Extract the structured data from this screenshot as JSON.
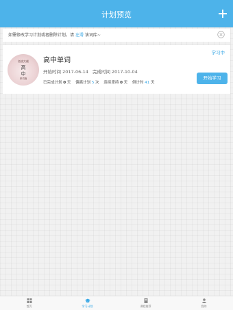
{
  "header": {
    "title": "计划预览",
    "add_icon": "plus-icon"
  },
  "notice": {
    "prefix": "如需修改学习计划或者删除计划，请",
    "link": "左滑",
    "suffix": "该词库~",
    "close_icon": "close-circle-icon"
  },
  "plan": {
    "status": "学习中",
    "cover": {
      "line1": "名校大佬",
      "line2": "高",
      "line3": "中",
      "line4": "单词篇"
    },
    "name": "高中单词",
    "start_label": "开始时间",
    "start_date": "2017-06-14",
    "end_label": "完成时间",
    "end_date": "2017-10-04",
    "stats": {
      "done_label": "已完成计划",
      "done_value": "0",
      "done_unit": "天",
      "behind_label": "偏离计划",
      "behind_value": "5",
      "behind_unit": "次",
      "streak_label": "连续坚持",
      "streak_value": "0",
      "streak_unit": "天",
      "remain_label": "倒计时",
      "remain_value": "41",
      "remain_unit": "天"
    },
    "start_button": "开始学习"
  },
  "tabs": [
    {
      "label": "首页",
      "icon": "home-grid-icon",
      "active": false
    },
    {
      "label": "学习计划",
      "icon": "graduation-cap-icon",
      "active": true
    },
    {
      "label": "课程推荐",
      "icon": "book-icon",
      "active": false
    },
    {
      "label": "我的",
      "icon": "user-icon",
      "active": false
    }
  ],
  "colors": {
    "accent": "#4db3ea",
    "link": "#39a8e6"
  }
}
